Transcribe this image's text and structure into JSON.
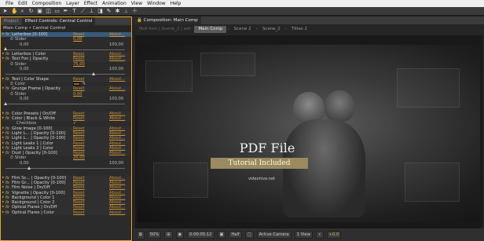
{
  "menu": [
    "File",
    "Edit",
    "Composition",
    "Layer",
    "Effect",
    "Animation",
    "View",
    "Window",
    "Help"
  ],
  "left_panel": {
    "tabs": [
      "Project",
      "Effect Controls: Central Control"
    ],
    "breadcrumb": "Main Comp • Central Control",
    "rows": [
      {
        "kind": "header",
        "name": "Letterbox [0-100]",
        "reset": "Reset",
        "about": "About...",
        "selected": true
      },
      {
        "kind": "sub",
        "name": "Slider",
        "value": "0,00"
      },
      {
        "kind": "range",
        "lo": "0,00",
        "hi": "100,00"
      },
      {
        "kind": "slider",
        "pos": 0
      },
      {
        "kind": "header",
        "name": "Letterbox | Color",
        "reset": "Reset",
        "about": "About..."
      },
      {
        "kind": "header",
        "name": "Text Fon | Opacity",
        "reset": "Reset",
        "about": "About..."
      },
      {
        "kind": "sub",
        "name": "Slider",
        "value": "75,00"
      },
      {
        "kind": "range",
        "lo": "0,00",
        "hi": "100,00"
      },
      {
        "kind": "slider",
        "pos": 0.75
      },
      {
        "kind": "header",
        "name": "Text | Color Shape",
        "reset": "Reset",
        "about": "About..."
      },
      {
        "kind": "color",
        "name": "Color"
      },
      {
        "kind": "header",
        "name": "Grunge Frame | Opacity",
        "reset": "Reset",
        "about": "About..."
      },
      {
        "kind": "sub",
        "name": "Slider",
        "value": "0,00"
      },
      {
        "kind": "range",
        "lo": "0,00",
        "hi": "100,00"
      },
      {
        "kind": "slider",
        "pos": 0
      },
      {
        "kind": "blank"
      },
      {
        "kind": "header",
        "name": "Color Presets | On/Off",
        "reset": "Reset",
        "about": "About..."
      },
      {
        "kind": "header",
        "name": "Color | Black & White",
        "reset": "Reset",
        "about": "About..."
      },
      {
        "kind": "checkbox",
        "name": "Checkbox"
      },
      {
        "kind": "header",
        "name": "Glow Image [0-100]",
        "reset": "Reset",
        "about": "About..."
      },
      {
        "kind": "header",
        "name": "Light L... | Opacity [0-100]",
        "reset": "Reset",
        "about": "About..."
      },
      {
        "kind": "header",
        "name": "Light L... | Opacity [0-100]",
        "reset": "Reset",
        "about": "About..."
      },
      {
        "kind": "header",
        "name": "Light Leaks 1 | Color",
        "reset": "Reset",
        "about": "About..."
      },
      {
        "kind": "header",
        "name": "Light Leaks 2 | Color",
        "reset": "Reset",
        "about": "About..."
      },
      {
        "kind": "header",
        "name": "Dust | Opacity [0-100]",
        "reset": "Reset",
        "about": "About..."
      },
      {
        "kind": "sub",
        "name": "Slider",
        "value": "20,00"
      },
      {
        "kind": "range",
        "lo": "0,00",
        "hi": "100,00"
      },
      {
        "kind": "slider",
        "pos": 0.2
      },
      {
        "kind": "blank"
      },
      {
        "kind": "header",
        "name": "Film Sc... | Opacity [0-100]",
        "reset": "Reset",
        "about": "About..."
      },
      {
        "kind": "header",
        "name": "Film Gr... | Opacity [0-100]",
        "reset": "Reset",
        "about": "About..."
      },
      {
        "kind": "header",
        "name": "Film Noise | On/Off",
        "reset": "Reset",
        "about": "About..."
      },
      {
        "kind": "header",
        "name": "Vignette | Opacity [0-100]",
        "reset": "Reset",
        "about": "About..."
      },
      {
        "kind": "header",
        "name": "Background | Color 1",
        "reset": "Reset",
        "about": "About..."
      },
      {
        "kind": "header",
        "name": "Background | Color 2",
        "reset": "Reset",
        "about": "About..."
      },
      {
        "kind": "header",
        "name": "Optical Flares | On/Off",
        "reset": "Reset",
        "about": "About..."
      },
      {
        "kind": "header",
        "name": "Optical Flares | Color",
        "reset": "Reset",
        "about": "About..."
      }
    ]
  },
  "right_panel": {
    "tab": "Composition: Main Comp",
    "comp_tabs": [
      "Main Comp",
      "Scene 2",
      "Scene_2",
      "Titles 2"
    ],
    "ghost_tab": "Null Iron | Scene_2 | ext",
    "viewer": {
      "title": "PDF File",
      "subtitle": "Tutorial Included",
      "small": "videohive.net"
    },
    "bottom": {
      "zoom": "50%",
      "timecode": "0:00:05:12",
      "resolution": "Half",
      "camera": "Active Camera",
      "view": "1 View",
      "exposure": "+0,0"
    }
  },
  "colors": {
    "accent": "#f0a020",
    "link": "#c89038",
    "tut_bar": "#9a8a5e"
  }
}
